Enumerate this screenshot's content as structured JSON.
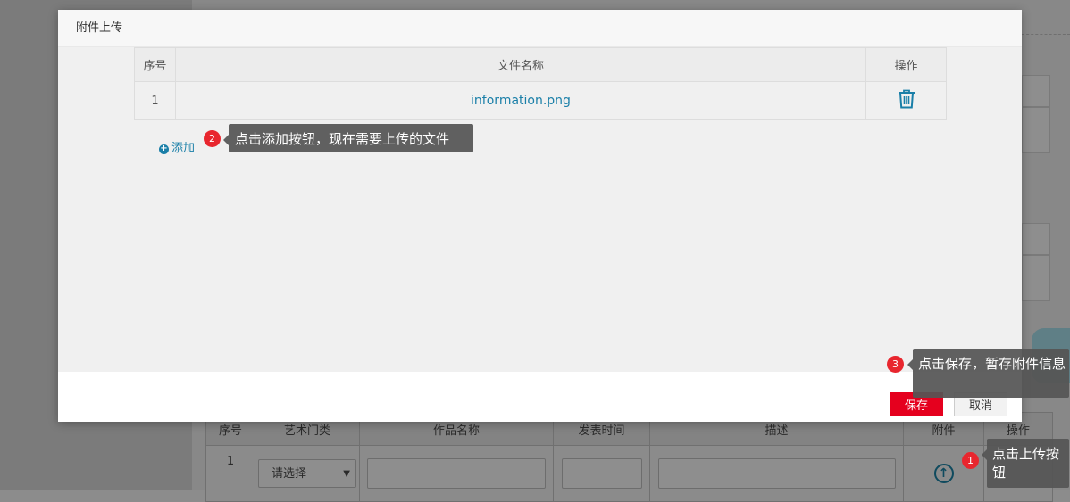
{
  "modal": {
    "title": "附件上传",
    "table": {
      "headers": [
        "序号",
        "文件名称",
        "操作"
      ],
      "rows": [
        {
          "index": "1",
          "filename": "information.png",
          "action_icon": "trash-icon"
        }
      ]
    },
    "add_label": "添加",
    "save_label": "保存",
    "cancel_label": "取消"
  },
  "background": {
    "table": {
      "headers": [
        "序号",
        "艺术门类",
        "作品名称",
        "发表时间",
        "描述",
        "附件",
        "操作"
      ],
      "row": {
        "index": "1",
        "category_select": "请选择",
        "attachment_icon": "upload-icon"
      }
    }
  },
  "tips": [
    {
      "step": "1",
      "text": "点击上传按钮"
    },
    {
      "step": "2",
      "text": "点击添加按钮，现在需要上传的文件"
    },
    {
      "step": "3",
      "text": "点击保存，暂存附件信息"
    }
  ],
  "colors": {
    "primary_link": "#1a7fa8",
    "save_button": "#e5001e",
    "badge": "#e8262e",
    "tip_background": "#555555"
  }
}
